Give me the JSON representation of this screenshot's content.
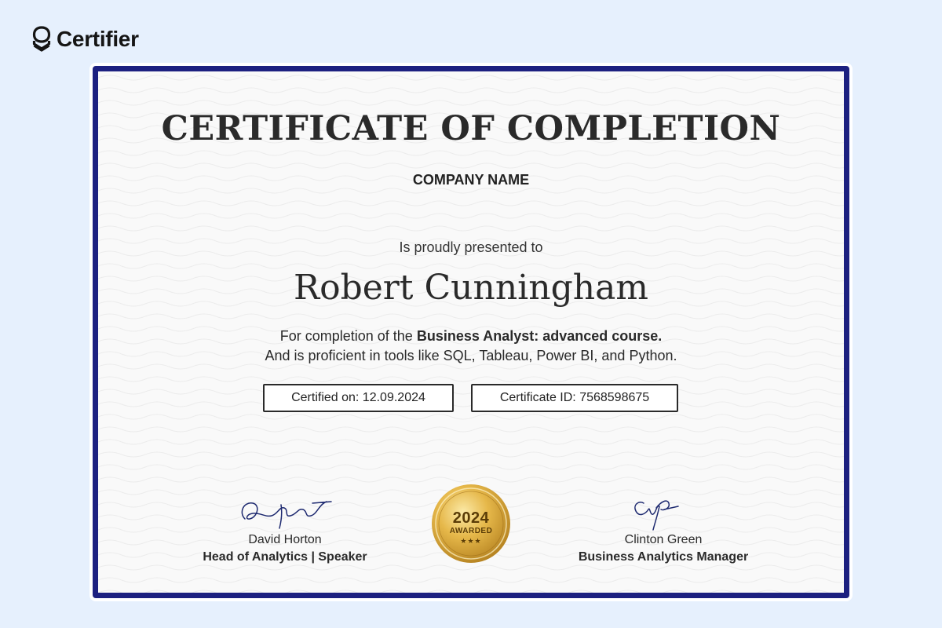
{
  "brand": {
    "name": "Certifier",
    "logo_icon": "certifier-logo-icon"
  },
  "certificate": {
    "title": "CERTIFICATE OF COMPLETION",
    "company": "COMPANY NAME",
    "presented_text": "Is proudly presented to",
    "recipient": "Robert Cunningham",
    "completion_prefix": "For completion of the",
    "course": "Business Analyst: advanced course.",
    "proficiency_line": "And is proficient in tools like SQL, Tableau, Power BI, and Python.",
    "certified_on": "Certified on: 12.09.2024",
    "certificate_id": "Certificate ID: 7568598675",
    "border_color": "#1c2080",
    "background_color": "#f9f9f9"
  },
  "signatories": [
    {
      "name": "David Horton",
      "role": "Head of Analytics | Speaker",
      "signature_icon": "signature-icon"
    },
    {
      "name": "Clinton Green",
      "role": "Business Analytics Manager",
      "signature_icon": "signature-icon"
    }
  ],
  "medal": {
    "year": "2024",
    "label": "AWARDED",
    "stars": "★★★",
    "icon": "gold-medal-icon",
    "gold_color": "#d9a93a"
  },
  "page": {
    "background": "#e6f0fd"
  }
}
